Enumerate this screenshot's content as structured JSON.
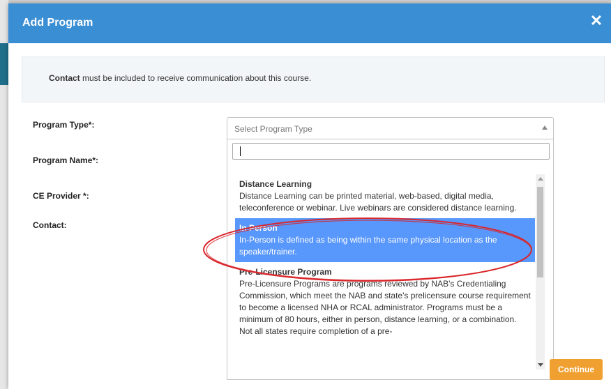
{
  "modal": {
    "title": "Add Program",
    "close_icon": "close-icon"
  },
  "notice": {
    "bold": "Contact",
    "text": " must be included to receive communication about this course."
  },
  "fields": {
    "program_type": "Program Type*:",
    "program_name": "Program Name*:",
    "ce_provider": "CE Provider *:",
    "contact": "Contact:"
  },
  "select": {
    "placeholder": "Select Program Type",
    "search_value": ""
  },
  "options": [
    {
      "title": "Distance Learning",
      "description": "Distance Learning can be printed material, web-based, digital media, teleconference or webinar. Live webinars are considered distance learning.",
      "selected": false
    },
    {
      "title": "In Person",
      "description": "In-Person is defined as being within the same physical location as the speaker/trainer.",
      "selected": true
    },
    {
      "title": "Pre-Licensure Program",
      "description": "Pre-Licensure Programs are programs reviewed by NAB's Credentialing Commission, which meet the NAB and state's prelicensure course requirement to become a licensed NHA or RCAL administrator. Programs must be a minimum of 80 hours, either in person, distance learning, or a combination. Not all states require completion of a pre-",
      "selected": false
    }
  ],
  "buttons": {
    "continue": "Continue"
  },
  "colors": {
    "header": "#3a8ed4",
    "selected": "#5897fb",
    "continue": "#f0a030",
    "annotation": "#d9262b"
  }
}
